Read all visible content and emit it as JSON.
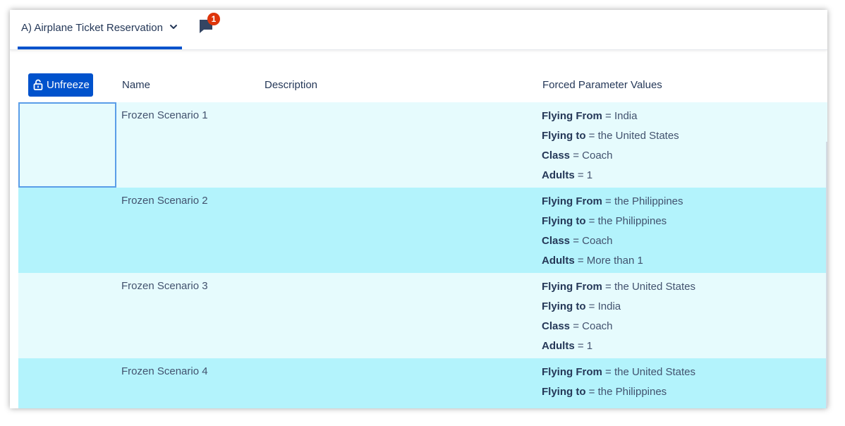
{
  "tab": {
    "label": "A) Airplane Ticket Reservation",
    "chevron_icon": "chevron-down-icon"
  },
  "comments": {
    "icon": "comment-icon",
    "badge_count": "1"
  },
  "table": {
    "unfreeze_label": "Unfreeze",
    "unfreeze_icon": "unlock-icon",
    "headers": {
      "name": "Name",
      "description": "Description",
      "forced_values": "Forced Parameter Values"
    },
    "rows": [
      {
        "name": "Frozen Scenario 1",
        "params": [
          {
            "key": "Flying From",
            "sep": " = ",
            "value": "India"
          },
          {
            "key": "Flying to",
            "sep": " = ",
            "value": "the United States"
          },
          {
            "key": "Class",
            "sep": " = ",
            "value": "Coach"
          },
          {
            "key": "Adults",
            "sep": " = ",
            "value": "1"
          }
        ]
      },
      {
        "name": "Frozen Scenario 2",
        "params": [
          {
            "key": "Flying From",
            "sep": " = ",
            "value": "the Philippines"
          },
          {
            "key": "Flying to",
            "sep": " = ",
            "value": "the Philippines"
          },
          {
            "key": "Class",
            "sep": " = ",
            "value": "Coach"
          },
          {
            "key": "Adults",
            "sep": " = ",
            "value": "More than 1"
          }
        ]
      },
      {
        "name": "Frozen Scenario 3",
        "params": [
          {
            "key": "Flying From",
            "sep": " = ",
            "value": "the United States"
          },
          {
            "key": "Flying to",
            "sep": " = ",
            "value": "India"
          },
          {
            "key": "Class",
            "sep": " = ",
            "value": "Coach"
          },
          {
            "key": "Adults",
            "sep": " = ",
            "value": "1"
          }
        ]
      },
      {
        "name": "Frozen Scenario 4",
        "params": [
          {
            "key": "Flying From",
            "sep": " = ",
            "value": "the United States"
          },
          {
            "key": "Flying to",
            "sep": " = ",
            "value": "the Philippines"
          }
        ]
      }
    ]
  },
  "colors": {
    "accent": "#0052cc",
    "badge": "#de350b",
    "row_light": "#e6fbfd",
    "row_dark": "#b3f3fc",
    "selection_border": "#5a9de8"
  }
}
